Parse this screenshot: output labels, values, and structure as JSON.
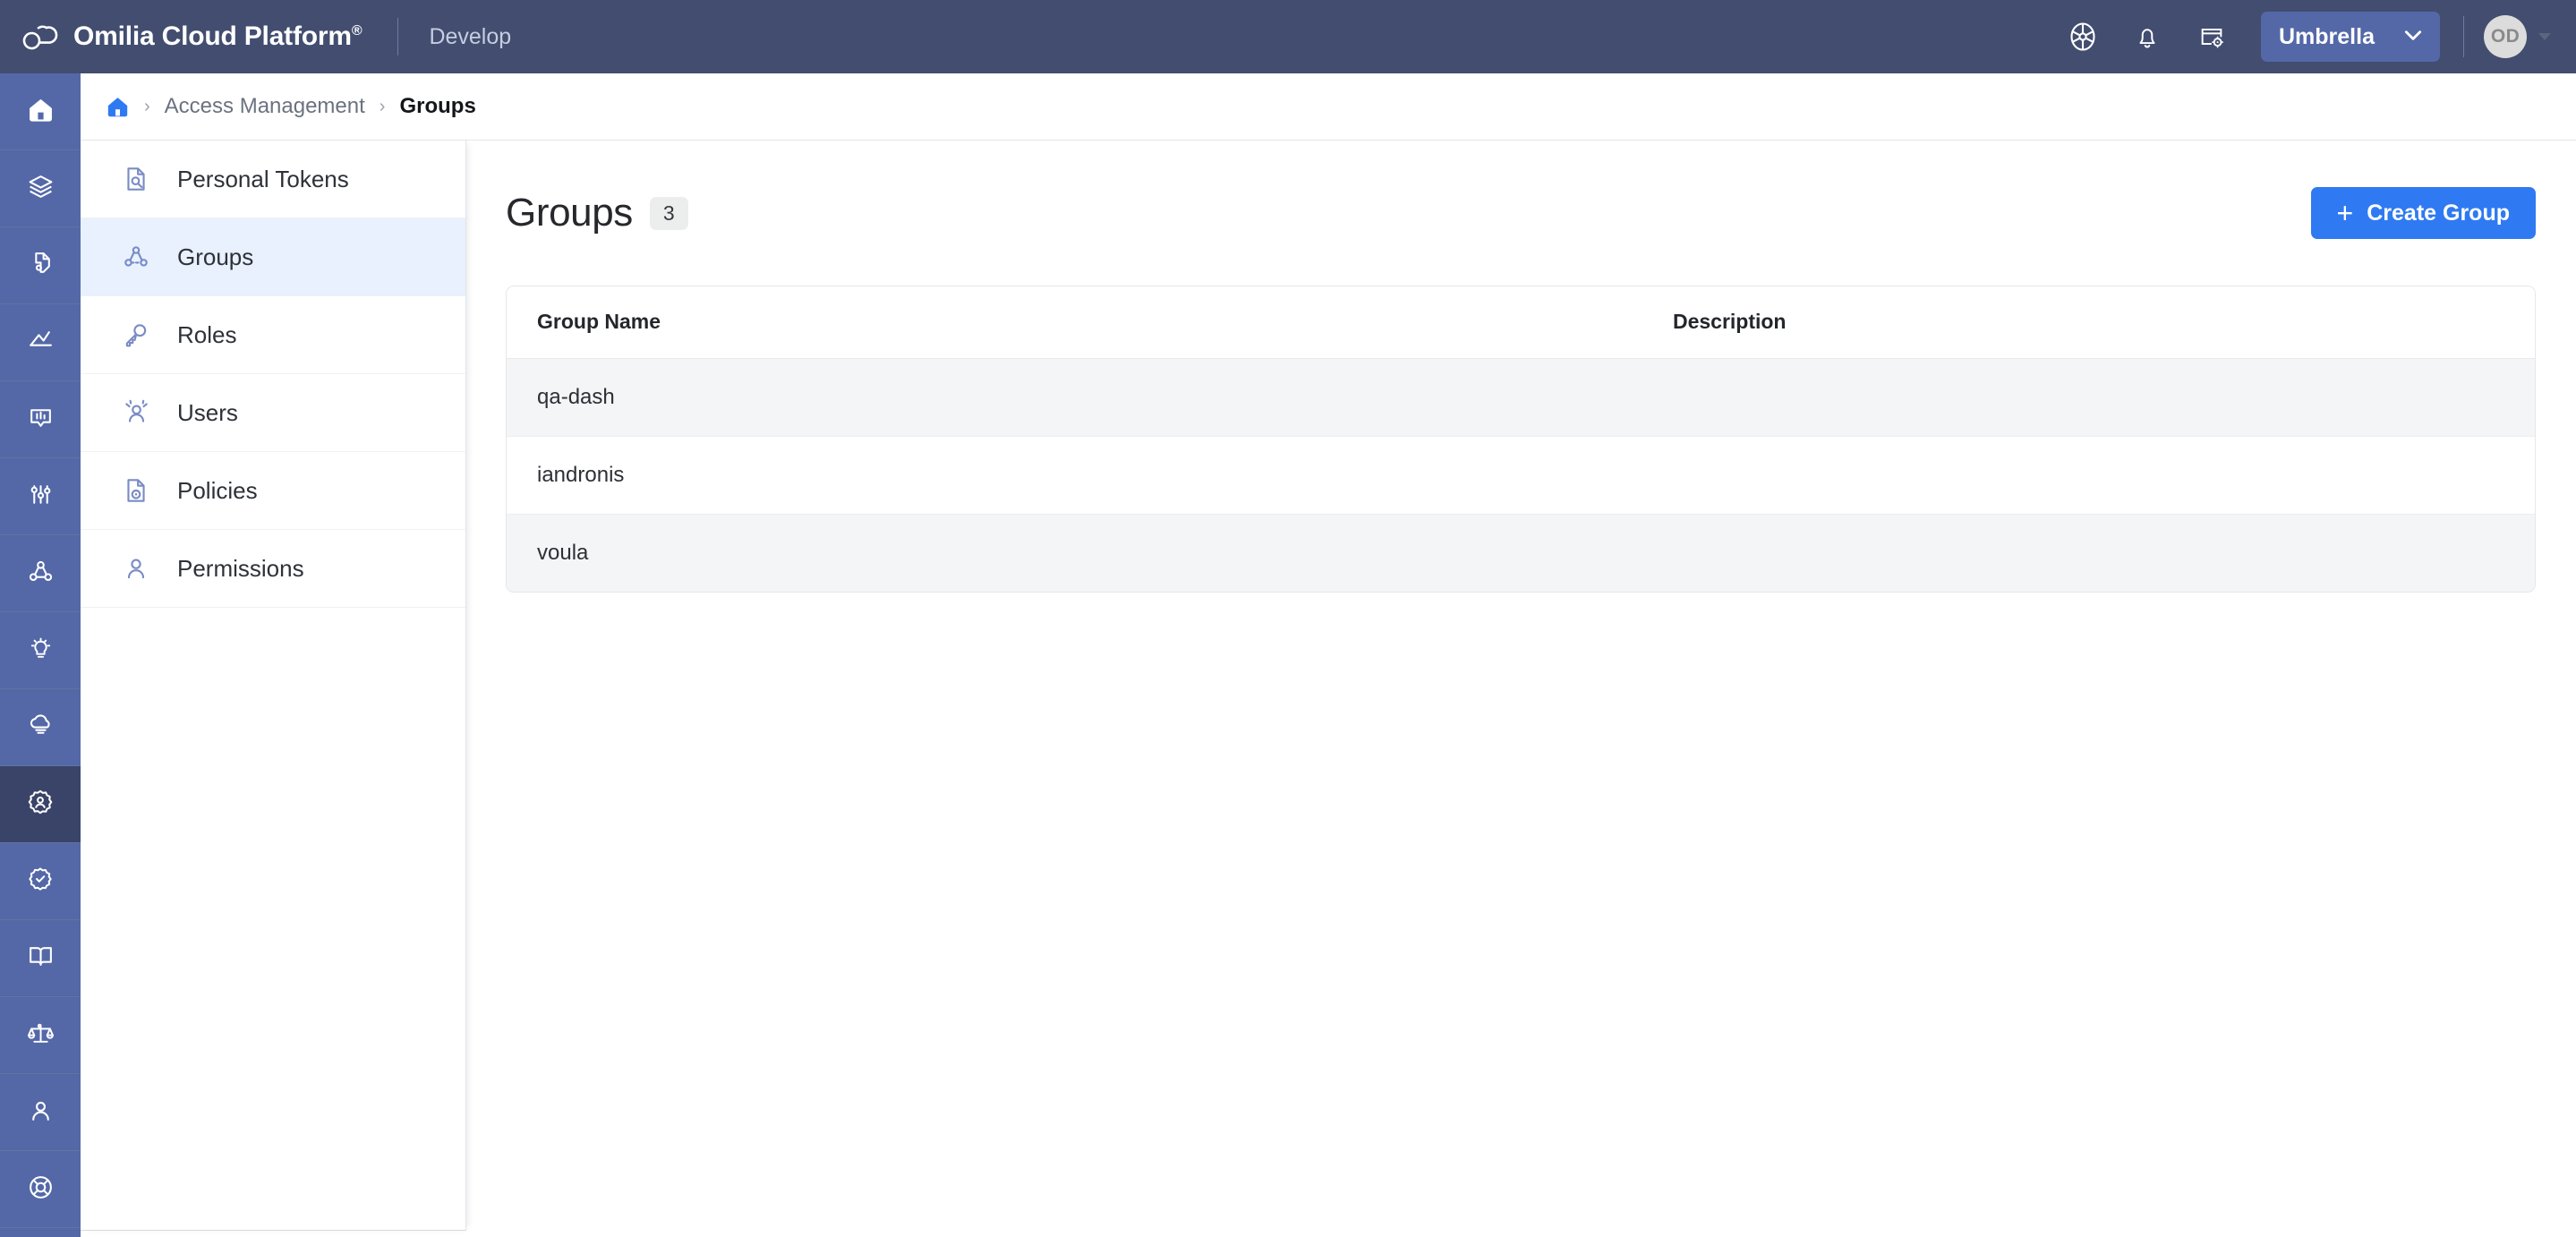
{
  "header": {
    "brand_name": "Omilia Cloud Platform",
    "brand_trademark": "®",
    "environment": "Develop",
    "logo_icon": "cloud-logo-icon",
    "icons": [
      {
        "name": "support-wheel-icon",
        "label": "Support"
      },
      {
        "name": "bell-icon",
        "label": "Notifications"
      },
      {
        "name": "app-settings-icon",
        "label": "Application Settings"
      }
    ],
    "tenant": {
      "label": "Umbrella",
      "chevron_icon": "chevron-down-icon"
    },
    "avatar": {
      "initials": "OD",
      "caret_icon": "caret-down-icon"
    }
  },
  "rail": {
    "items": [
      {
        "name": "home",
        "icon": "home-icon",
        "active": false
      },
      {
        "name": "layers",
        "icon": "layers-icon",
        "active": false
      },
      {
        "name": "tag",
        "icon": "tag-3d-icon",
        "active": false
      },
      {
        "name": "analytics",
        "icon": "chart-line-icon",
        "active": false
      },
      {
        "name": "conversations",
        "icon": "speech-meter-icon",
        "active": false
      },
      {
        "name": "tuning",
        "icon": "sliders-icon",
        "active": false
      },
      {
        "name": "flows",
        "icon": "node-graph-icon",
        "active": false
      },
      {
        "name": "insights",
        "icon": "lightbulb-icon",
        "active": false
      },
      {
        "name": "cloud",
        "icon": "cloud-icon",
        "active": false
      },
      {
        "name": "access-management",
        "icon": "gear-person-icon",
        "active": true
      },
      {
        "name": "quality",
        "icon": "badge-check-icon",
        "active": false
      },
      {
        "name": "docs",
        "icon": "book-open-icon",
        "active": false
      },
      {
        "name": "compliance",
        "icon": "scales-icon",
        "active": false
      },
      {
        "name": "profile",
        "icon": "person-icon",
        "active": false
      },
      {
        "name": "help",
        "icon": "lifebuoy-icon",
        "active": false
      }
    ]
  },
  "breadcrumb": {
    "home_icon": "home-icon",
    "separator": "›",
    "items": [
      {
        "label": "Access Management",
        "current": false
      },
      {
        "label": "Groups",
        "current": true
      }
    ]
  },
  "subnav": {
    "items": [
      {
        "label": "Personal Tokens",
        "icon": "token-doc-icon",
        "active": false
      },
      {
        "label": "Groups",
        "icon": "groups-icon",
        "active": true
      },
      {
        "label": "Roles",
        "icon": "key-icon",
        "active": false
      },
      {
        "label": "Users",
        "icon": "users-icon",
        "active": false
      },
      {
        "label": "Policies",
        "icon": "policy-doc-icon",
        "active": false
      },
      {
        "label": "Permissions",
        "icon": "person-icon",
        "active": false
      }
    ]
  },
  "main": {
    "title": "Groups",
    "count": "3",
    "create_button": {
      "label": "Create Group",
      "plus": "+"
    },
    "table": {
      "columns": [
        "Group Name",
        "Description"
      ],
      "rows": [
        {
          "name": "qa-dash",
          "description": ""
        },
        {
          "name": "iandronis",
          "description": ""
        },
        {
          "name": "voula",
          "description": ""
        }
      ]
    }
  },
  "colors": {
    "header_bg": "#424d70",
    "rail_bg": "#5468a8",
    "rail_active_bg": "#3a4468",
    "accent_blue": "#2f7af2",
    "subnav_active_bg": "#e8f1fd",
    "row_alt_bg": "#f4f5f6",
    "icon_blue": "#7a8cc4"
  }
}
